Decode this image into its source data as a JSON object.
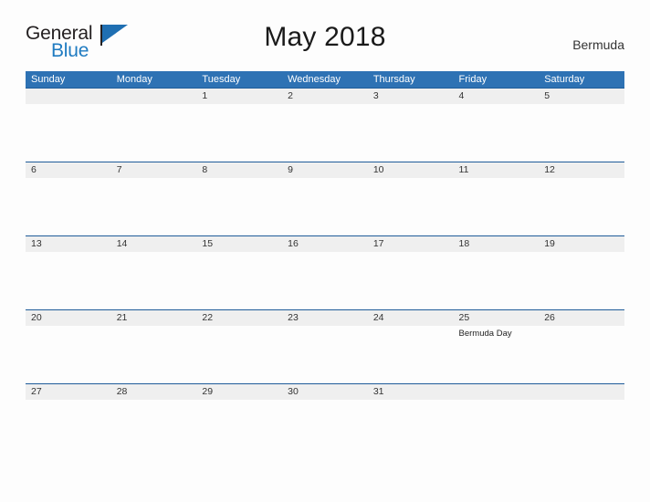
{
  "brand": {
    "name_part1": "General",
    "name_part2": "Blue",
    "flag_icon": "flag-triangle-icon",
    "colors": {
      "general_text": "#231f20",
      "blue_text": "#1f7bc1",
      "flag": "#1f6fb2"
    }
  },
  "header": {
    "title": "May 2018",
    "location": "Bermuda"
  },
  "theme": {
    "header_blue": "#2e72b4",
    "band_gray": "#efefef",
    "band_border_blue": "#1f5c99",
    "page_background": "#fdfdfd"
  },
  "calendar": {
    "weekdays": [
      "Sunday",
      "Monday",
      "Tuesday",
      "Wednesday",
      "Thursday",
      "Friday",
      "Saturday"
    ],
    "weeks": [
      [
        {
          "day": "",
          "event": ""
        },
        {
          "day": "",
          "event": ""
        },
        {
          "day": "1",
          "event": ""
        },
        {
          "day": "2",
          "event": ""
        },
        {
          "day": "3",
          "event": ""
        },
        {
          "day": "4",
          "event": ""
        },
        {
          "day": "5",
          "event": ""
        }
      ],
      [
        {
          "day": "6",
          "event": ""
        },
        {
          "day": "7",
          "event": ""
        },
        {
          "day": "8",
          "event": ""
        },
        {
          "day": "9",
          "event": ""
        },
        {
          "day": "10",
          "event": ""
        },
        {
          "day": "11",
          "event": ""
        },
        {
          "day": "12",
          "event": ""
        }
      ],
      [
        {
          "day": "13",
          "event": ""
        },
        {
          "day": "14",
          "event": ""
        },
        {
          "day": "15",
          "event": ""
        },
        {
          "day": "16",
          "event": ""
        },
        {
          "day": "17",
          "event": ""
        },
        {
          "day": "18",
          "event": ""
        },
        {
          "day": "19",
          "event": ""
        }
      ],
      [
        {
          "day": "20",
          "event": ""
        },
        {
          "day": "21",
          "event": ""
        },
        {
          "day": "22",
          "event": ""
        },
        {
          "day": "23",
          "event": ""
        },
        {
          "day": "24",
          "event": ""
        },
        {
          "day": "25",
          "event": "Bermuda Day"
        },
        {
          "day": "26",
          "event": ""
        }
      ],
      [
        {
          "day": "27",
          "event": ""
        },
        {
          "day": "28",
          "event": ""
        },
        {
          "day": "29",
          "event": ""
        },
        {
          "day": "30",
          "event": ""
        },
        {
          "day": "31",
          "event": ""
        },
        {
          "day": "",
          "event": ""
        },
        {
          "day": "",
          "event": ""
        }
      ]
    ]
  }
}
